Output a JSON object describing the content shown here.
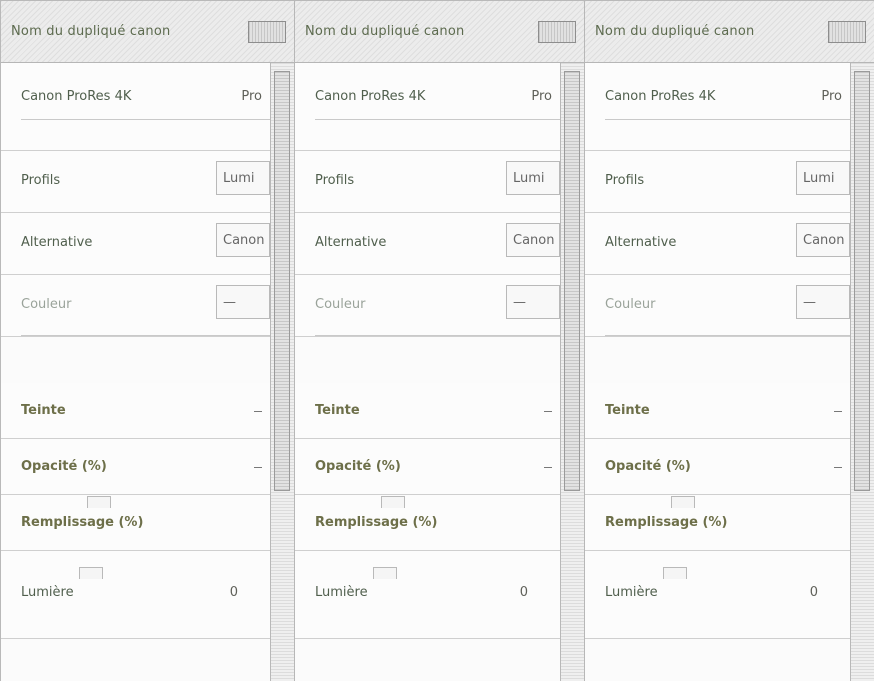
{
  "panels": [
    {
      "title": "Nom du dupliqué canon",
      "current_value_label": "Canon ProRes 4K",
      "current_value_short": "Pro",
      "profile_label": "Profils",
      "profile_value": "Lumi",
      "alternative_label": "Alternative",
      "alternative_value": "Canon",
      "colour_label": "Couleur",
      "colour_value": "—",
      "hue_label": "Teinte",
      "hue_value": "—",
      "opacity_label": "Opacité (%)",
      "opacity_value": "—",
      "fill_label": "Remplissage (%)",
      "light_label": "Lumière",
      "light_value": "0"
    },
    {
      "title": "Nom du dupliqué canon",
      "current_value_label": "Canon ProRes 4K",
      "current_value_short": "Pro",
      "profile_label": "Profils",
      "profile_value": "Lumi",
      "alternative_label": "Alternative",
      "alternative_value": "Canon",
      "colour_label": "Couleur",
      "colour_value": "—",
      "hue_label": "Teinte",
      "hue_value": "—",
      "opacity_label": "Opacité (%)",
      "opacity_value": "—",
      "fill_label": "Remplissage (%)",
      "light_label": "Lumière",
      "light_value": "0"
    },
    {
      "title": "Nom du dupliqué canon",
      "current_value_label": "Canon ProRes 4K",
      "current_value_short": "Pro",
      "profile_label": "Profils",
      "profile_value": "Lumi",
      "alternative_label": "Alternative",
      "alternative_value": "Canon",
      "colour_label": "Couleur",
      "colour_value": "—",
      "hue_label": "Teinte",
      "hue_value": "—",
      "opacity_label": "Opacité (%)",
      "opacity_value": "—",
      "fill_label": "Remplissage (%)",
      "light_label": "Lumière",
      "light_value": "0"
    }
  ]
}
